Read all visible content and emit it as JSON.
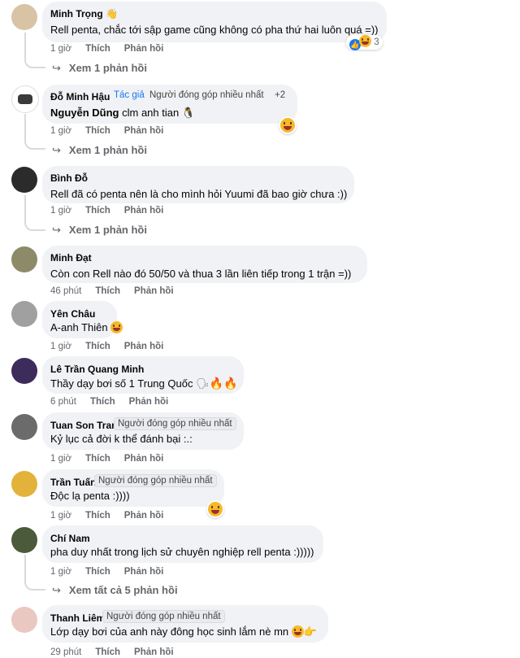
{
  "comments": [
    {
      "name": "Minh Trọng",
      "name_emoji": "👋",
      "text": "Rell penta, chắc tới sập game cũng không có pha thứ hai luôn quá =))",
      "time": "1 giờ",
      "like": "Thích",
      "reply": "Phản hồi",
      "replies": "Xem 1 phản hồi",
      "reaction_count": "3",
      "avatar_color": "#d9c3a5"
    },
    {
      "name": "Đỗ Minh Hậu",
      "author_badge": "Tác giả",
      "contributor_badge": "Người đóng góp nhiều nhất",
      "extra": "+2",
      "mention": "Nguyễn Dũng",
      "text": "clm anh tian 🐧",
      "time": "1 giờ",
      "like": "Thích",
      "reply": "Phản hồi",
      "replies": "Xem 1 phản hồi",
      "avatar_color": "#3a3a3a"
    },
    {
      "name": "Bình Đỗ",
      "text": "Rell đã có penta nên là cho mình hỏi Yuumi đã bao giờ chưa :))",
      "time": "1 giờ",
      "like": "Thích",
      "reply": "Phản hồi",
      "replies": "Xem 1 phản hồi",
      "avatar_color": "#2b2b2b"
    },
    {
      "name": "Minh Đạt",
      "text": "Còn con Rell nào đó 50/50 và thua 3 lần liên tiếp trong 1 trận =))",
      "time": "46 phút",
      "like": "Thích",
      "reply": "Phản hồi",
      "avatar_color": "#8d8a6a"
    },
    {
      "name": "Yên Châu",
      "text": "A-anh Thiên",
      "time": "1 giờ",
      "like": "Thích",
      "reply": "Phản hồi",
      "avatar_color": "#a0a0a0"
    },
    {
      "name": "Lê Trần Quang Minh",
      "text": "Thầy dạy bơi số 1 Trung Quốc",
      "time": "6 phút",
      "like": "Thích",
      "reply": "Phản hồi",
      "avatar_color": "#3d2b5c"
    },
    {
      "name": "Tuan Son Tran",
      "contributor_badge": "Người đóng góp nhiều nhất",
      "text": "Kỷ lục cả đời k thể đánh bại :.:",
      "time": "1 giờ",
      "like": "Thích",
      "reply": "Phản hồi",
      "avatar_color": "#6b6b6b"
    },
    {
      "name": "Trần Tuấn",
      "contributor_badge": "Người đóng góp nhiều nhất",
      "text": "Độc lạ penta :))))",
      "time": "1 giờ",
      "like": "Thích",
      "reply": "Phản hồi",
      "avatar_color": "#e2b23b"
    },
    {
      "name": "Chí Nam",
      "text": "pha duy nhất trong lịch sử chuyên nghiệp rell penta :)))))",
      "time": "1 giờ",
      "like": "Thích",
      "reply": "Phản hồi",
      "replies": "Xem tất cả 5 phản hồi",
      "avatar_color": "#4a5a3a"
    },
    {
      "name": "Thanh Liêm",
      "contributor_badge": "Người đóng góp nhiều nhất",
      "text": "Lớp dạy bơi của anh này đông học sinh lắm nè mn",
      "time": "29 phút",
      "like": "Thích",
      "reply": "Phản hồi",
      "avatar_color": "#e8c8c0"
    }
  ]
}
